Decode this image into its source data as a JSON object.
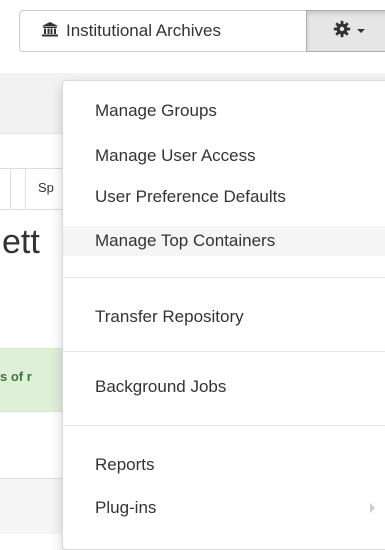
{
  "background": {
    "tab_label": "Sp",
    "heading_fragment": "ett",
    "alert_fragment": "s of r",
    "alert_color": "#3c763d"
  },
  "toolbar": {
    "repository_icon": "institution-icon",
    "repository_label": "Institutional Archives",
    "gear_icon": "gear-icon"
  },
  "menu": {
    "items": [
      {
        "label": "Manage Groups"
      },
      {
        "label": "Manage User Access"
      },
      {
        "label": "User Preference Defaults"
      },
      {
        "label": "Manage Top Containers",
        "highlighted": true
      },
      {
        "label": "Transfer Repository"
      },
      {
        "label": "Background Jobs"
      },
      {
        "label": "Reports"
      },
      {
        "label": "Plug-ins",
        "has_submenu": true
      }
    ]
  }
}
